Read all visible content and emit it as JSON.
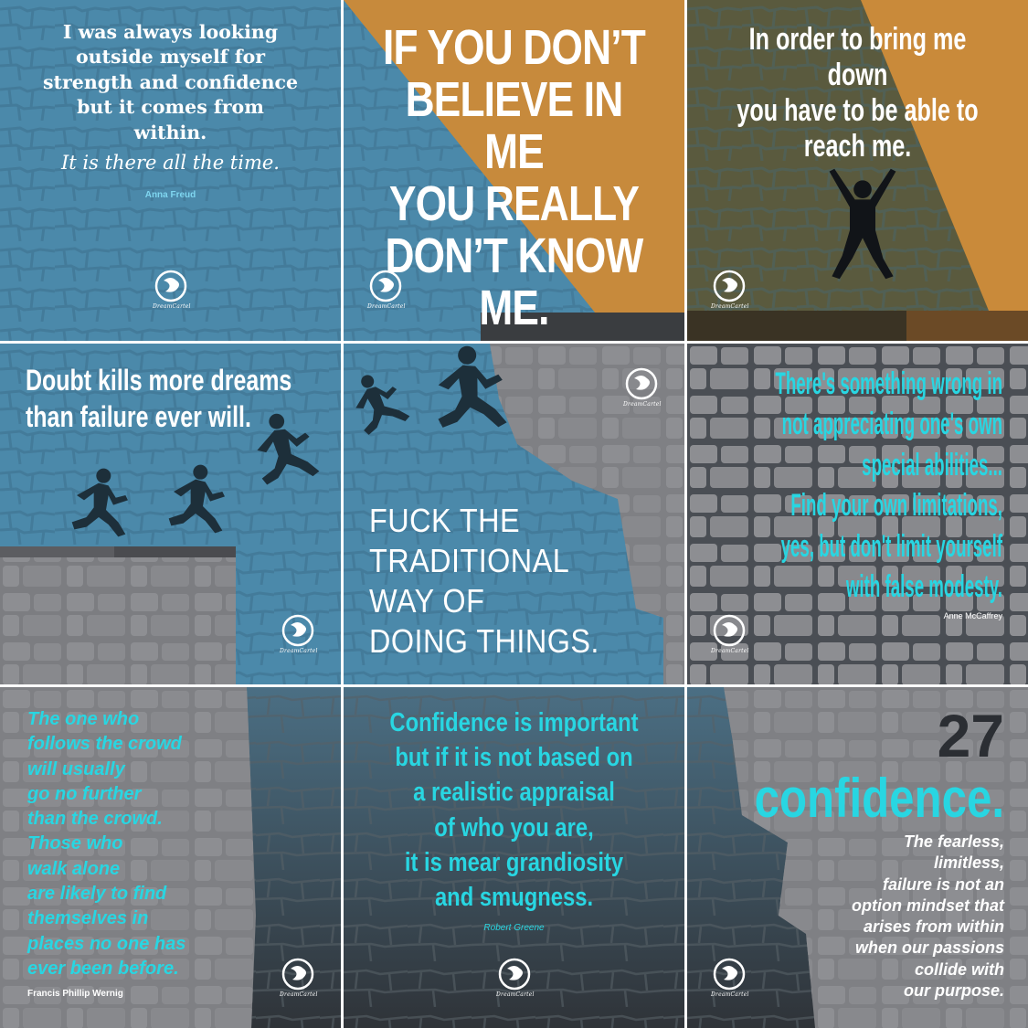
{
  "logo_text": "DreamCartel",
  "tiles": {
    "t1": {
      "lines": [
        "I was always looking",
        "outside myself for",
        "strength and confidence",
        "but it comes from",
        "within."
      ],
      "sub": "It is there all the time.",
      "author": "Anna Freud"
    },
    "t2": {
      "lines": [
        "IF YOU DON’T",
        "BELIEVE IN ME",
        "YOU REALLY",
        "DON’T KNOW",
        "ME."
      ]
    },
    "t3": {
      "lines": [
        "In order to bring me down",
        "you have to be able to",
        "reach me."
      ]
    },
    "t4": {
      "lines": [
        "Doubt kills more dreams",
        "than failure ever will."
      ]
    },
    "t5": {
      "lines": [
        "FUCK THE",
        "TRADITIONAL",
        "WAY OF",
        "DOING THINGS."
      ]
    },
    "t6": {
      "lines": [
        "There's something wrong in",
        "not appreciating one's own",
        "special abilities...",
        "Find your own limitations,",
        "yes, but don't limit yourself",
        "with false modesty."
      ],
      "author": "Anne McCaffrey"
    },
    "t7": {
      "lines": [
        "The one who",
        "follows the crowd",
        "will usually",
        "go no further",
        "than the crowd.",
        "Those who",
        "walk alone",
        "are likely to find",
        "themselves in",
        "places no one has",
        "ever been before."
      ],
      "author": "Francis Phillip Wernig"
    },
    "t8": {
      "lines": [
        "Confidence is important",
        "but if it is not based on",
        "a realistic appraisal",
        "of who you are,",
        "it is mear grandiosity",
        "and smugness."
      ],
      "author": "Robert Greene"
    },
    "t9": {
      "number": "27",
      "title": "confidence.",
      "lines": [
        "The fearless,",
        "limitless,",
        "failure is not an",
        "option mindset that",
        "arises from within",
        "when our passions",
        "collide with",
        "our purpose."
      ]
    }
  },
  "colors": {
    "blue": "#4a86a6",
    "orange": "#c98c3e",
    "cyan": "#23d3e0",
    "stone": "#8c8d91",
    "dark": "#3e4349"
  }
}
